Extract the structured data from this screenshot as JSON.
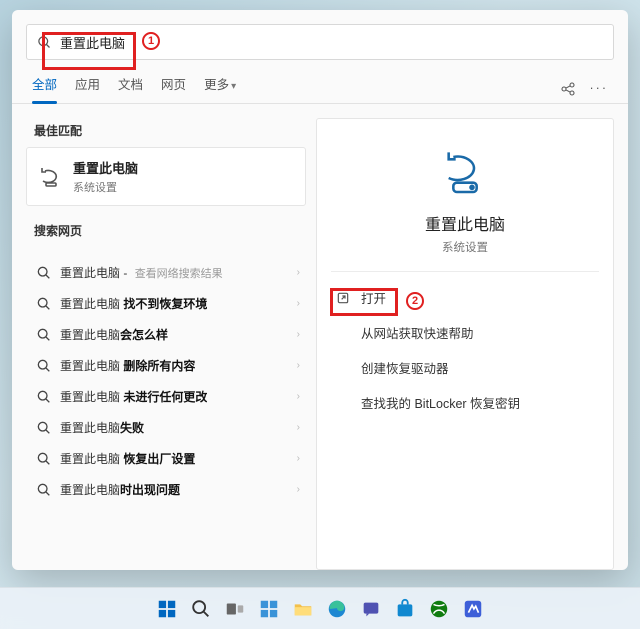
{
  "search": {
    "value": "重置此电脑"
  },
  "tabs": {
    "items": [
      {
        "label": "全部"
      },
      {
        "label": "应用"
      },
      {
        "label": "文档"
      },
      {
        "label": "网页"
      },
      {
        "label": "更多"
      }
    ]
  },
  "left": {
    "bestHeader": "最佳匹配",
    "best": {
      "title": "重置此电脑",
      "sub": "系统设置"
    },
    "webHeader": "搜索网页",
    "rows": [
      {
        "prefix": "重置此电脑",
        "bold": "",
        "hint": "查看网络搜索结果"
      },
      {
        "prefix": "重置此电脑 ",
        "bold": "找不到恢复环境",
        "hint": ""
      },
      {
        "prefix": "重置此电脑",
        "bold": "会怎么样",
        "hint": ""
      },
      {
        "prefix": "重置此电脑 ",
        "bold": "删除所有内容",
        "hint": ""
      },
      {
        "prefix": "重置此电脑 ",
        "bold": "未进行任何更改",
        "hint": ""
      },
      {
        "prefix": "重置此电脑",
        "bold": "失败",
        "hint": ""
      },
      {
        "prefix": "重置此电脑 ",
        "bold": "恢复出厂设置",
        "hint": ""
      },
      {
        "prefix": "重置此电脑",
        "bold": "时出现问题",
        "hint": ""
      }
    ]
  },
  "detail": {
    "title": "重置此电脑",
    "sub": "系统设置",
    "actions": [
      {
        "label": "打开",
        "icon": "open"
      },
      {
        "label": "从网站获取快速帮助",
        "icon": ""
      },
      {
        "label": "创建恢复驱动器",
        "icon": ""
      },
      {
        "label": "查找我的 BitLocker 恢复密钥",
        "icon": ""
      }
    ]
  },
  "annotations": {
    "step1": "1",
    "step2": "2"
  }
}
